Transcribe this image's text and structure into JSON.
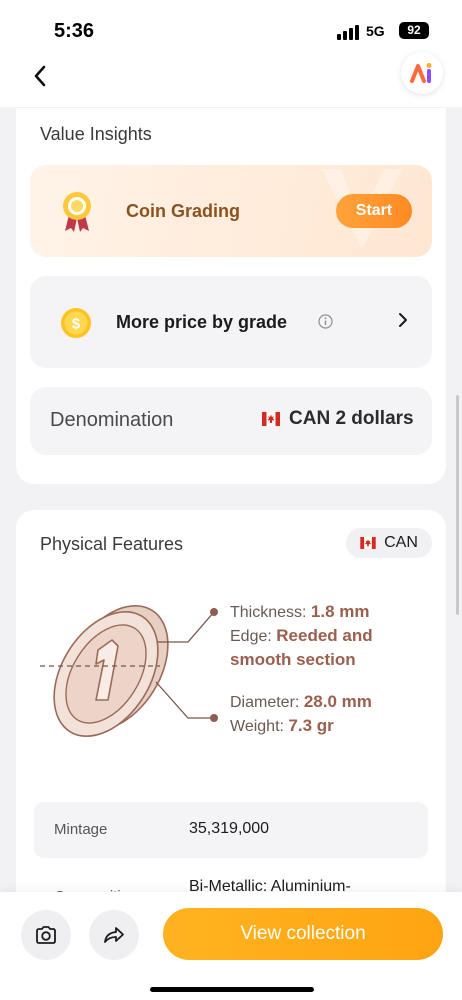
{
  "status": {
    "time": "5:36",
    "network": "5G",
    "battery": "92"
  },
  "nav": {
    "back_icon": "chevron-left-icon",
    "logo": "ai-app-logo"
  },
  "value_insights": {
    "title": "Value Insights",
    "grading": {
      "label": "Coin Grading",
      "button": "Start",
      "icon": "award-ribbon-icon"
    },
    "price": {
      "label": "More price by grade",
      "icon": "dollar-coin-icon",
      "info_icon": "info-icon",
      "chevron": "chevron-right-icon"
    },
    "denomination": {
      "label": "Denomination",
      "country": "CAN",
      "value": "2 dollars",
      "flag_icon": "canada-flag-icon"
    }
  },
  "physical": {
    "title": "Physical Features",
    "country_chip": "CAN",
    "thickness_label": "Thickness:",
    "thickness_value": "1.8 mm",
    "edge_label": "Edge:",
    "edge_value_1": "Reeded and",
    "edge_value_2": "smooth section",
    "diameter_label": "Diameter:",
    "diameter_value": "28.0 mm",
    "weight_label": "Weight:",
    "weight_value": "7.3 gr",
    "mintage_label": "Mintage",
    "mintage_value": "35,319,000",
    "composition_label": "Composition",
    "composition_value": "Bi-Metallic: Aluminium-"
  },
  "bottom": {
    "camera_icon": "camera-icon",
    "share_icon": "share-icon",
    "view_collection": "View collection"
  },
  "colors": {
    "accent": "#ffa412",
    "grading_text": "#8a5320",
    "feature_value": "#9b5f4d"
  }
}
